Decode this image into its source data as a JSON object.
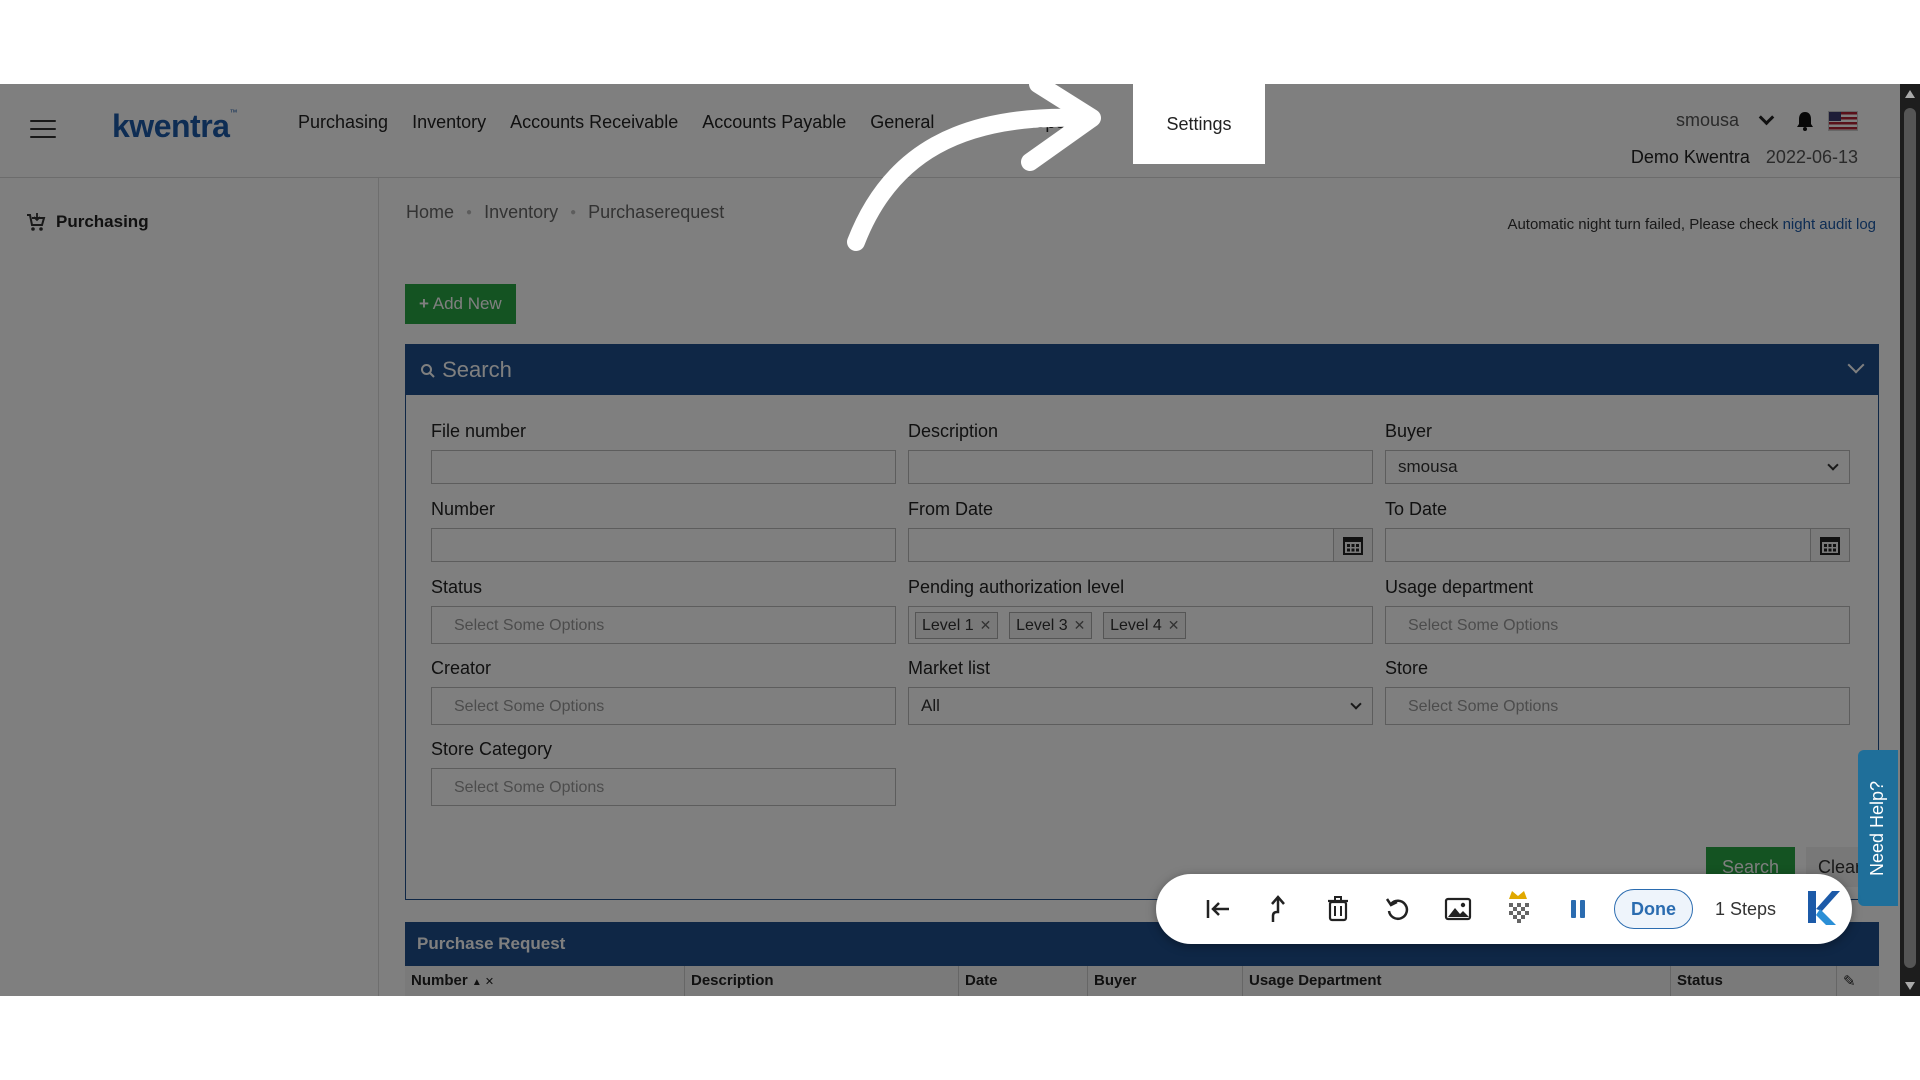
{
  "header": {
    "logo": "kwentra",
    "nav": [
      "Purchasing",
      "Inventory",
      "Accounts Receivable",
      "Accounts Payable",
      "General",
      "",
      "Reports"
    ],
    "username": "smousa",
    "company": "Demo Kwentra",
    "date": "2022-06-13",
    "icons": [
      "menu-icon",
      "chevron-down-icon",
      "bell-icon",
      "us-flag-icon"
    ]
  },
  "highlight": {
    "label": "Settings"
  },
  "sidebar": {
    "items": [
      {
        "label": "Purchasing",
        "icon": "cart-icon"
      }
    ]
  },
  "breadcrumb": [
    "Home",
    "Inventory",
    "Purchaserequest"
  ],
  "alert": {
    "text": "Automatic night turn failed, Please check ",
    "link": "night audit log"
  },
  "add_new": "Add New",
  "search_panel": {
    "title": "Search",
    "fields": {
      "file_number": {
        "label": "File number",
        "value": ""
      },
      "description": {
        "label": "Description",
        "value": ""
      },
      "buyer": {
        "label": "Buyer",
        "value": "smousa"
      },
      "number": {
        "label": "Number",
        "value": ""
      },
      "from_date": {
        "label": "From Date",
        "value": ""
      },
      "to_date": {
        "label": "To Date",
        "value": ""
      },
      "status": {
        "label": "Status",
        "placeholder": "Select Some Options"
      },
      "pending_level": {
        "label": "Pending authorization level",
        "tags": [
          "Level 1",
          "Level 3",
          "Level 4"
        ]
      },
      "usage_department": {
        "label": "Usage department",
        "placeholder": "Select Some Options"
      },
      "creator": {
        "label": "Creator",
        "placeholder": "Select Some Options"
      },
      "market_list": {
        "label": "Market list",
        "value": "All"
      },
      "store": {
        "label": "Store",
        "placeholder": "Select Some Options"
      },
      "store_category": {
        "label": "Store Category",
        "placeholder": "Select Some Options"
      }
    },
    "search_button": "Search",
    "clear_button": "Clear"
  },
  "table": {
    "title": "Purchase Request",
    "columns": [
      "Number",
      "Description",
      "Date",
      "Buyer",
      "Usage Department",
      "Status"
    ]
  },
  "need_help": "Need Help?",
  "recorder": {
    "done": "Done",
    "steps": "1 Steps",
    "icons": [
      "step-back-icon",
      "upload-arrow-icon",
      "trash-icon",
      "undo-icon",
      "image-icon",
      "blur-crown-icon",
      "pause-icon",
      "kwentra-k-icon"
    ]
  },
  "colors": {
    "brand_blue": "#1e4f8c",
    "green": "#28a745",
    "link": "#1c5aa8"
  }
}
